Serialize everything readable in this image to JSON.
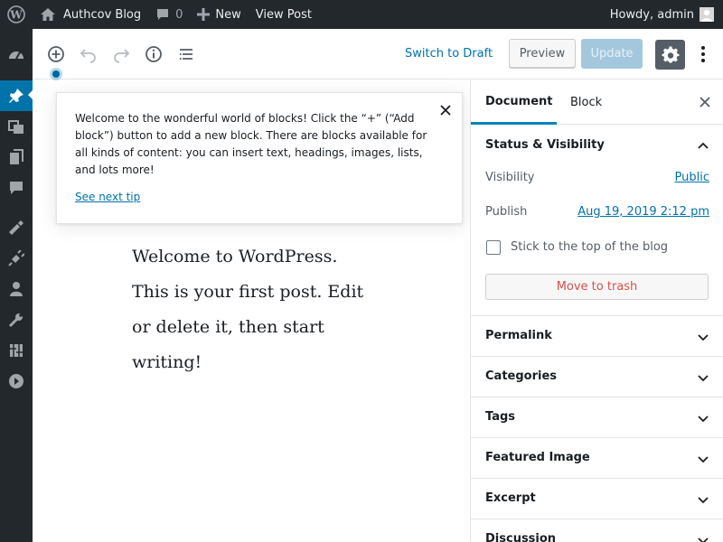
{
  "admin_bar": {
    "site_name": "Authcov Blog",
    "comment_count": "0",
    "new_label": "New",
    "view_post": "View Post",
    "howdy": "Howdy, admin"
  },
  "sidebar_icons": [
    "dashboard-icon",
    "posts-icon",
    "media-icon",
    "pages-icon",
    "comments-icon",
    "appearance-icon",
    "plugins-icon",
    "users-icon",
    "tools-icon",
    "settings-icon",
    "collapse-icon"
  ],
  "toolbar": {
    "switch_to_draft": "Switch to Draft",
    "preview": "Preview",
    "update": "Update"
  },
  "tip": {
    "text": "Welcome to the wonderful world of blocks! Click the “+” (“Add block”) button to add a new block. There are blocks available for all kinds of content: you can insert text, headings, images, lists, and lots more!",
    "next": "See next tip"
  },
  "post": {
    "content": "Welcome to WordPress. This is your first post. Edit or delete it, then start writing!"
  },
  "settings": {
    "tab_document": "Document",
    "tab_block": "Block",
    "status_title": "Status & Visibility",
    "visibility_label": "Visibility",
    "visibility_value": "Public",
    "publish_label": "Publish",
    "publish_value": "Aug 19, 2019 2:12 pm",
    "stick_label": "Stick to the top of the blog",
    "trash": "Move to trash",
    "panels": [
      "Permalink",
      "Categories",
      "Tags",
      "Featured Image",
      "Excerpt",
      "Discussion"
    ]
  },
  "colors": {
    "admin_bar": "#23282d",
    "accent": "#0073aa",
    "active_menu": "#0073aa",
    "trash": "#d94f4f"
  }
}
